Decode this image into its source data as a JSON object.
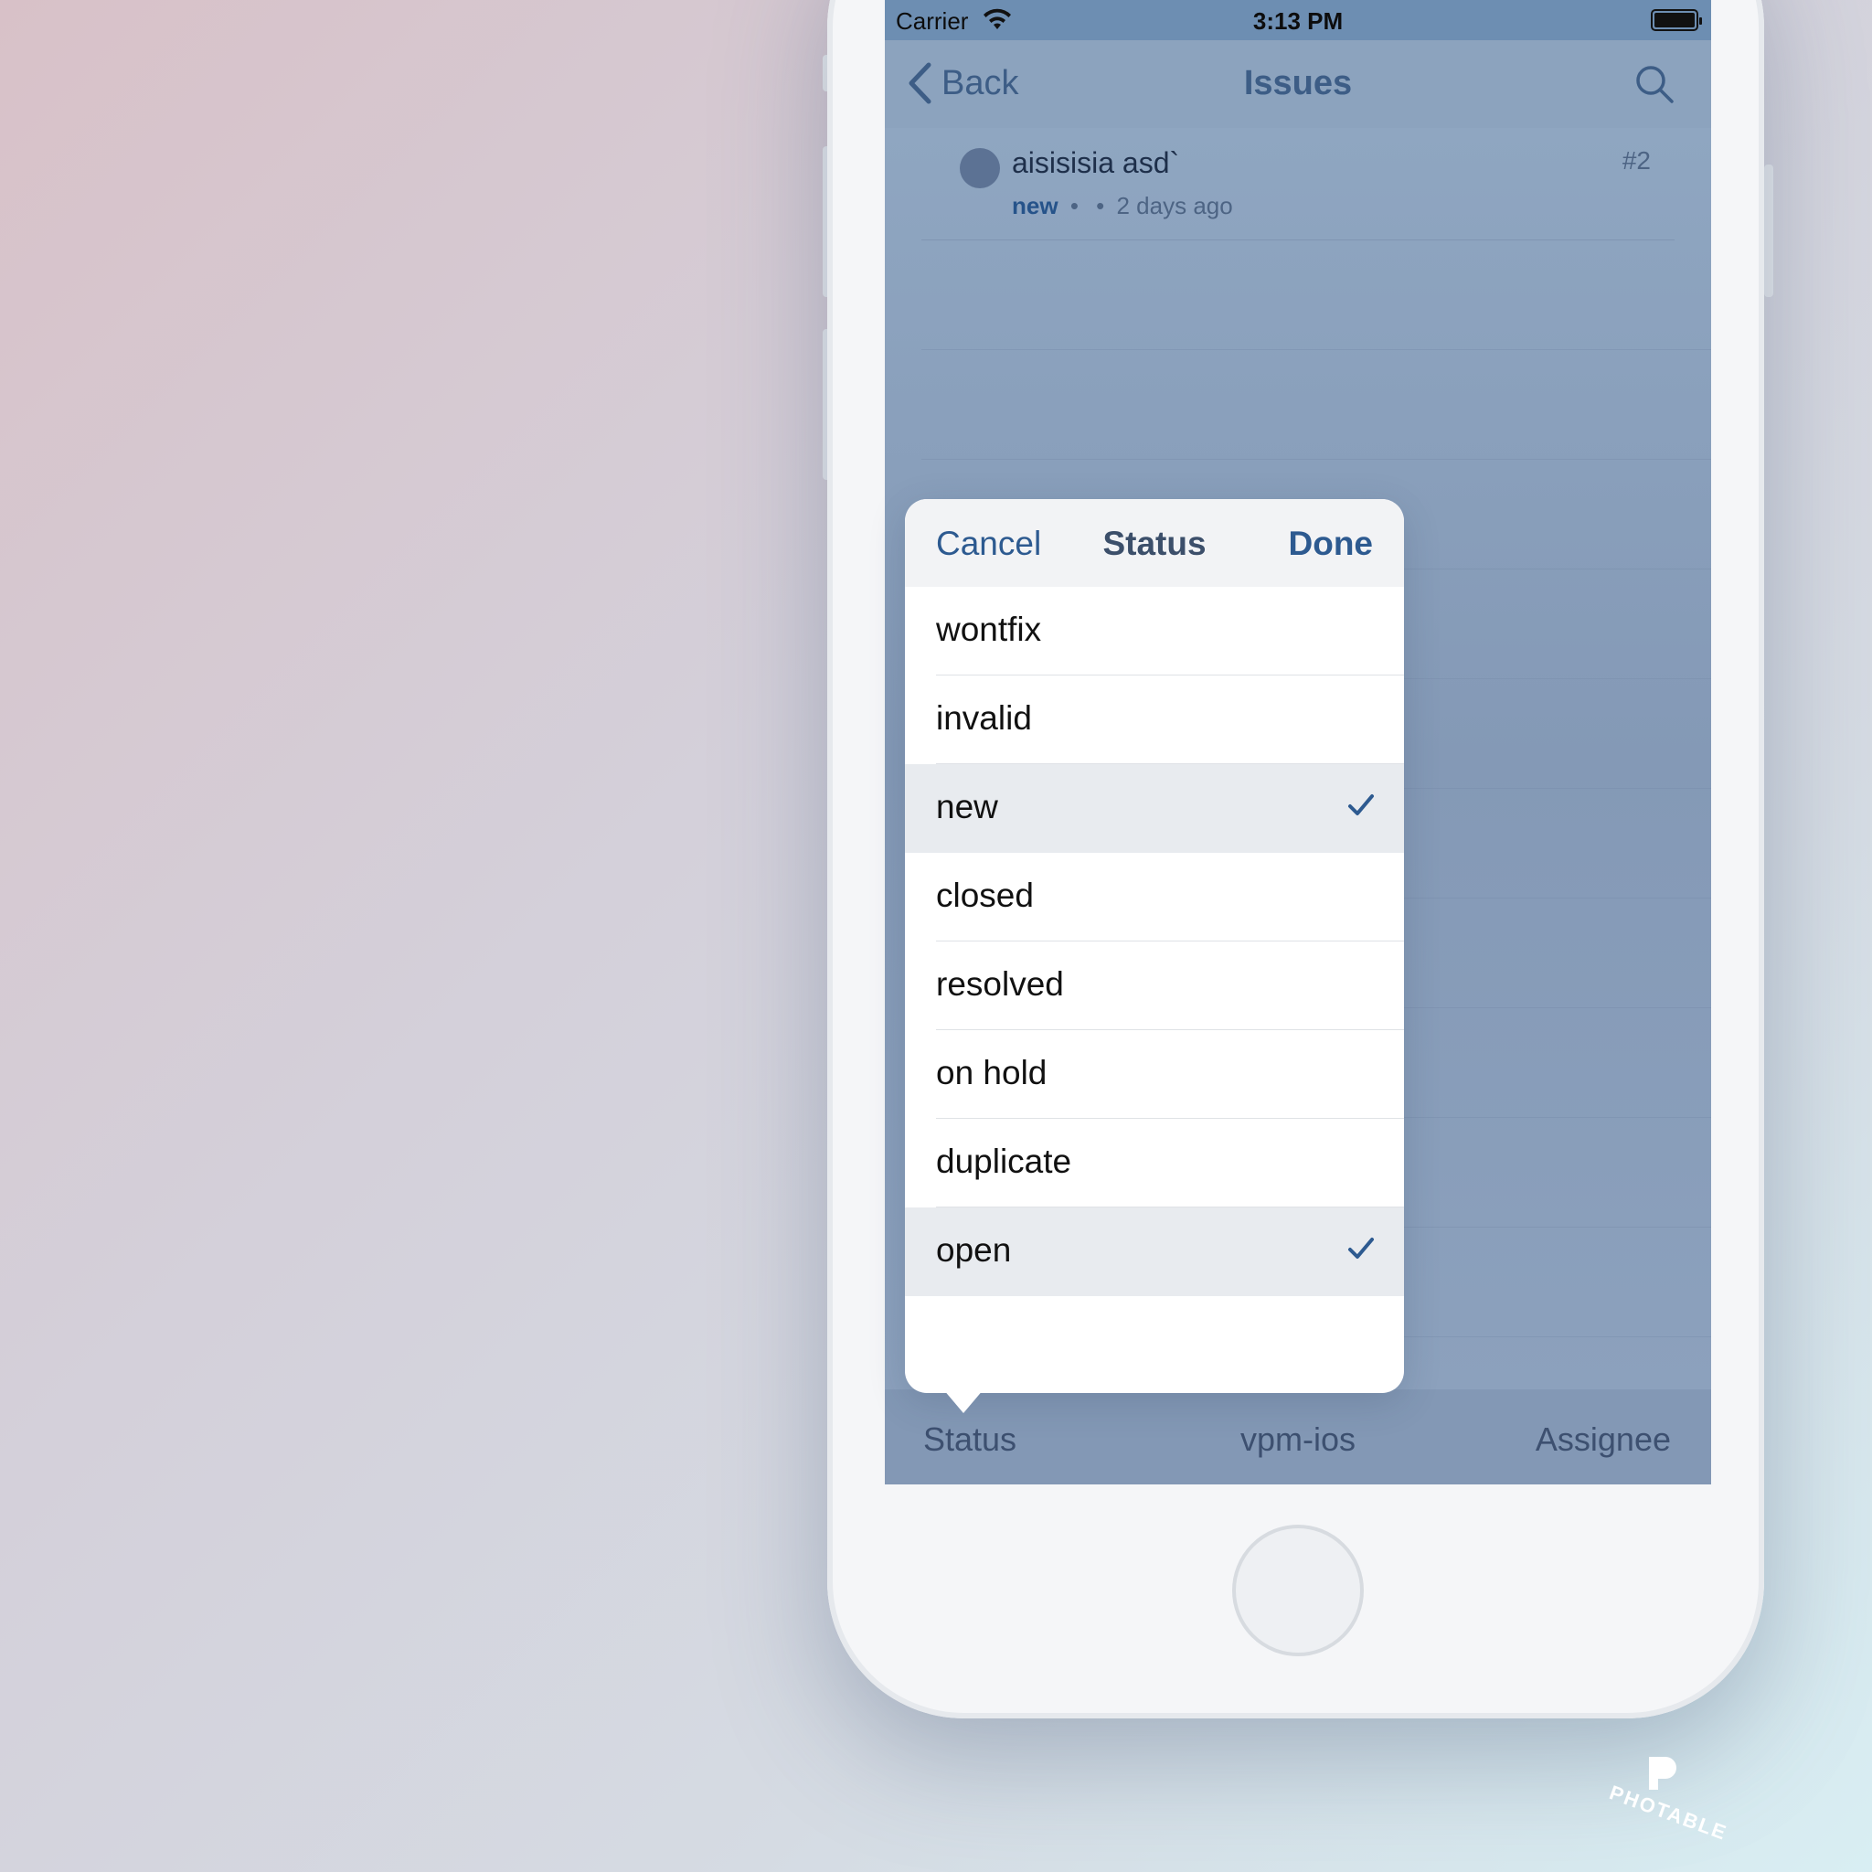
{
  "status_bar": {
    "carrier": "Carrier",
    "time": "3:13 PM"
  },
  "nav": {
    "back_label": "Back",
    "title": "Issues"
  },
  "issue": {
    "title": "aisisisia asd`",
    "number": "#2",
    "status": "new",
    "bullet1": "•",
    "bullet2": "•",
    "age": "2 days ago"
  },
  "popover": {
    "cancel_label": "Cancel",
    "title": "Status",
    "done_label": "Done",
    "options": [
      {
        "label": "wontfix",
        "selected": false
      },
      {
        "label": "invalid",
        "selected": false
      },
      {
        "label": "new",
        "selected": true
      },
      {
        "label": "closed",
        "selected": false
      },
      {
        "label": "resolved",
        "selected": false
      },
      {
        "label": "on hold",
        "selected": false
      },
      {
        "label": "duplicate",
        "selected": false
      },
      {
        "label": "open",
        "selected": true
      }
    ]
  },
  "tab_bar": {
    "status_label": "Status",
    "project_label": "vpm-ios",
    "assignee_label": "Assignee"
  },
  "watermark": {
    "text": "PHOTABLE"
  },
  "colors": {
    "accent": "#2d5a90",
    "nav_bar": "#8ca3be",
    "status_bar": "#6d8eb2",
    "selected_row": "#e8ebef",
    "issue_dot": "#5c7294"
  },
  "icons": {
    "back": "chevron-left-icon",
    "search": "search-icon",
    "wifi": "wifi-icon",
    "battery": "battery-icon",
    "check": "checkmark-icon"
  }
}
